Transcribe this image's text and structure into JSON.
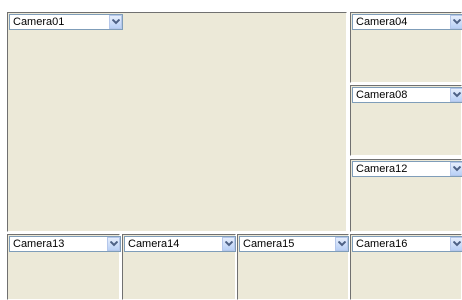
{
  "cameras": [
    {
      "label": "Camera01"
    },
    {
      "label": "Camera04"
    },
    {
      "label": "Camera08"
    },
    {
      "label": "Camera12"
    },
    {
      "label": "Camera13"
    },
    {
      "label": "Camera14"
    },
    {
      "label": "Camera15"
    },
    {
      "label": "Camera16"
    }
  ],
  "dropdown_icon": "chevron-down-icon",
  "colors": {
    "pane_background": "#ece9d8",
    "select_border": "#7f9db9",
    "arrow_button": "#c3d3fd",
    "arrow": "#4d6185"
  }
}
